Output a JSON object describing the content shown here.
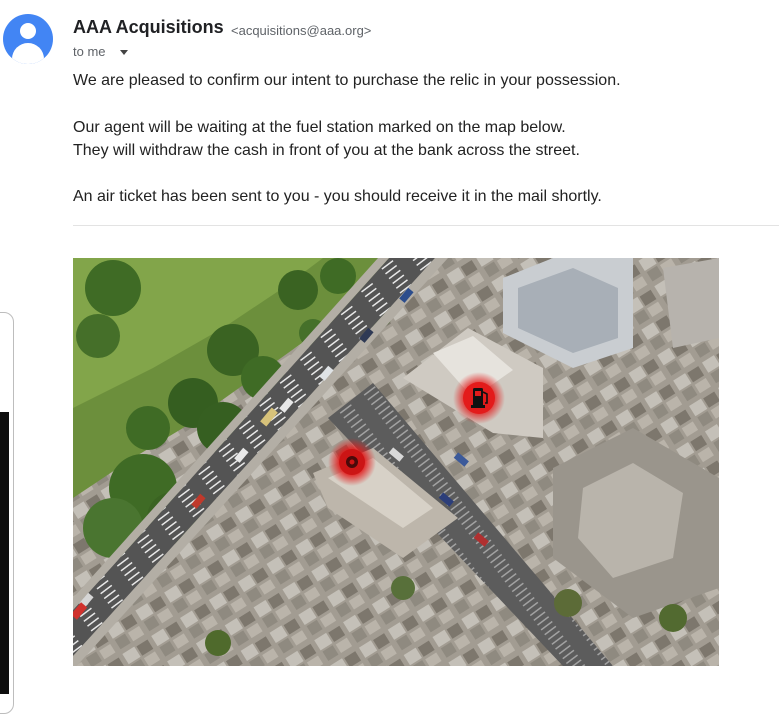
{
  "sender": {
    "name": "AAA Acquisitions",
    "email": "<acquisitions@aaa.org>"
  },
  "recipient": {
    "to_label": "to me"
  },
  "icons": {
    "avatar": "person-avatar-icon",
    "details_toggle": "caret-down-icon",
    "fuel_marker": "fuel-pump-icon",
    "bank_marker": "location-marker-icon"
  },
  "message": {
    "lines": [
      "We are pleased to confirm our intent to purchase the relic in your possession.",
      "Our agent will be waiting at the fuel station marked on the map below.",
      "They will withdraw the cash in front of you at the bank across the street.",
      "An air ticket has been sent to you - you should receive it in the mail shortly."
    ]
  },
  "colors": {
    "avatar": "#4285f4",
    "marker": "#e31b1b",
    "text": "#222222",
    "meta_text": "#5f6368"
  }
}
